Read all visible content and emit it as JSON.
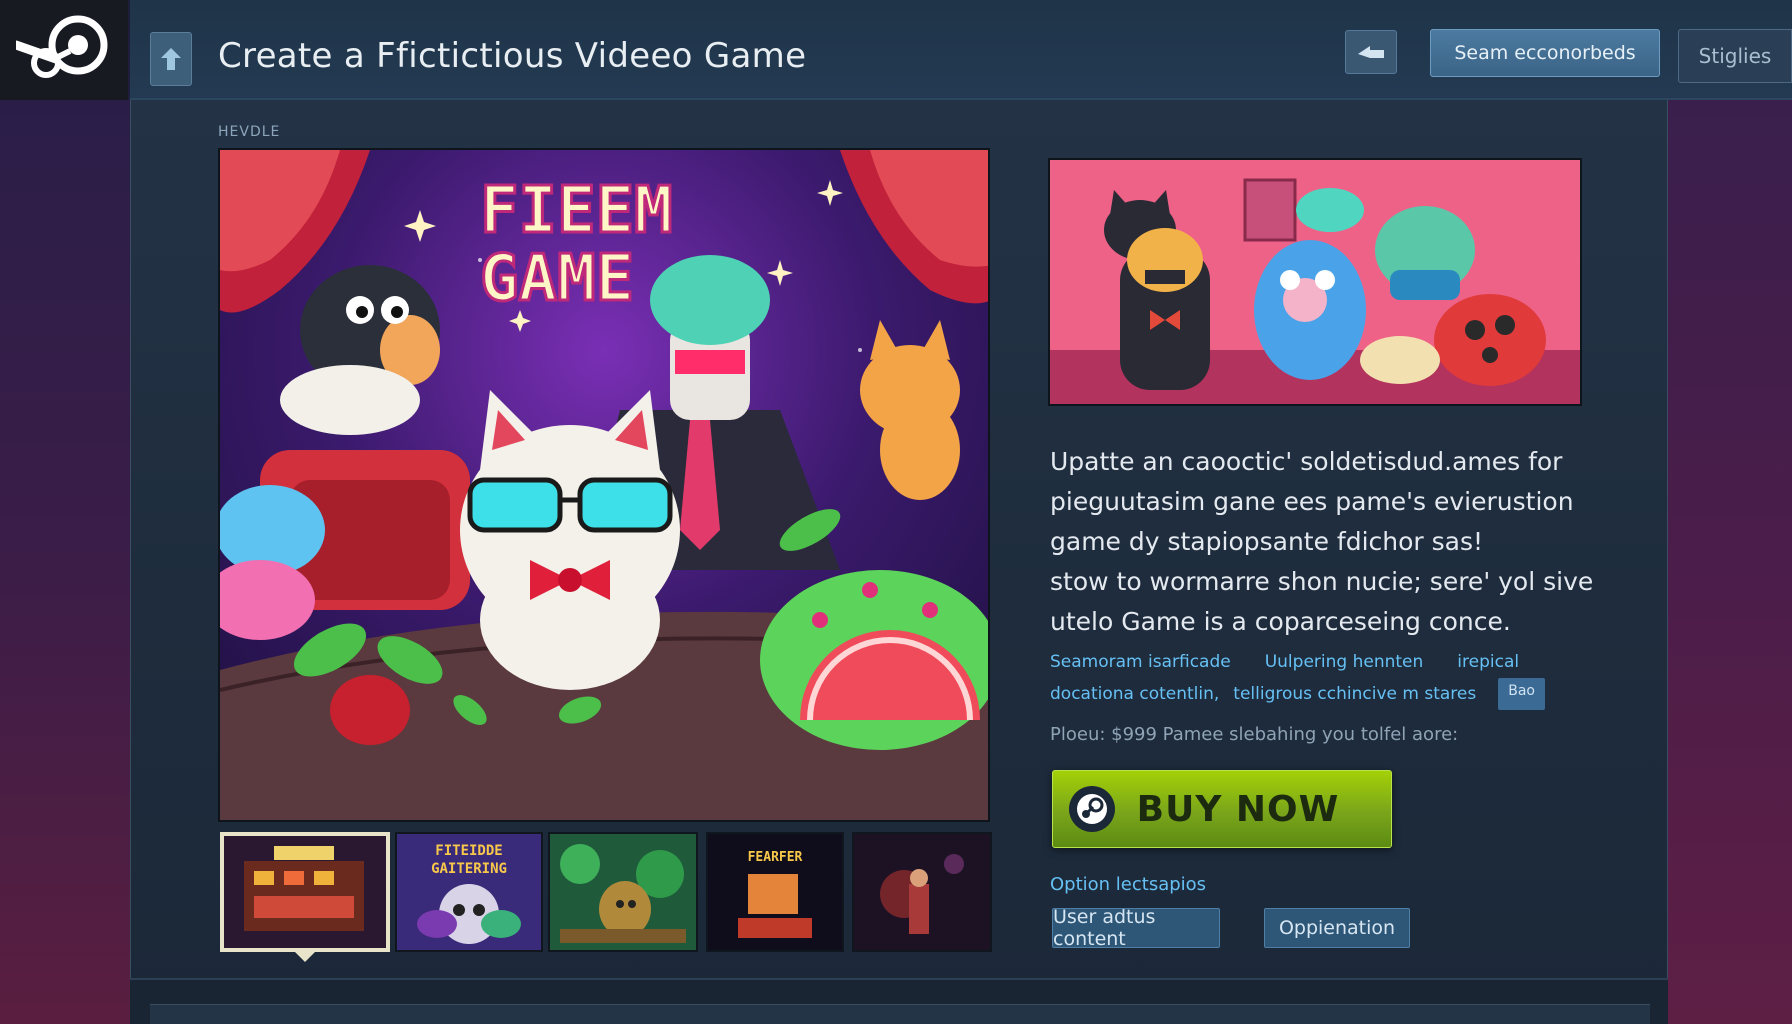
{
  "topbar": {
    "title": "Create a Ffictictious Videeo Game",
    "btn_primary": "Seam ecconorbeds",
    "btn_secondary": "Stiglies"
  },
  "section_label": "HEVDLE",
  "hero": {
    "title_line1": "FIEEM",
    "title_line2": "GAME"
  },
  "thumbs": [
    {
      "caption": ""
    },
    {
      "caption": "FITEIDDE GAITERING"
    },
    {
      "caption": ""
    },
    {
      "caption": "FEARFER"
    },
    {
      "caption": ""
    }
  ],
  "description": [
    "Upatte an caooctic' soldetisdud.ames for",
    "pieguutasim gane ees pame's evierustion",
    "game dy stapiopsante fdichor sas!",
    "stow to wormarre shon nucie; sere' yol  sive",
    "utelo Game is a coparceseing conce."
  ],
  "meta": {
    "row1": [
      "Seamoram isarficade",
      "Uulpering hennten",
      "irepical"
    ],
    "row2": [
      "docationa cotentlin,",
      "telligrous cchincive m stares"
    ],
    "tag": "Bao"
  },
  "price_line": "Ploeu:  $999 Pamee slebahing you tolfel aore:",
  "buy": {
    "label": "BUY NOW"
  },
  "options": {
    "label": "Option lectsapios",
    "buttons": [
      "User adtus content",
      "Oppienation"
    ]
  },
  "colors": {
    "accent": "#66c0f4",
    "buy_green": "#a4d007",
    "panel": "#1b2838"
  }
}
